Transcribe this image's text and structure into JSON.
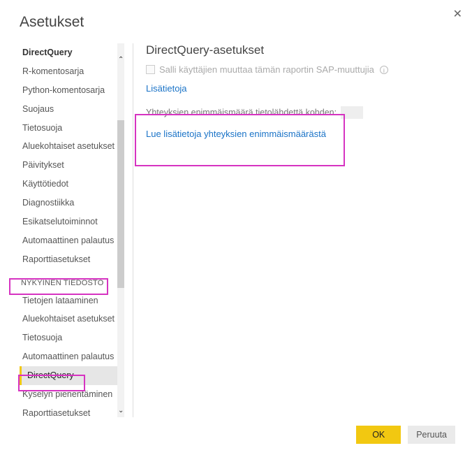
{
  "dialog": {
    "title": "Asetukset",
    "close_glyph": "✕"
  },
  "sidebar": {
    "global_items": [
      "DirectQuery",
      "R-komentosarja",
      "Python-komentosarja",
      "Suojaus",
      "Tietosuoja",
      "Aluekohtaiset asetukset",
      "Päivitykset",
      "Käyttötiedot",
      "Diagnostiikka",
      "Esikatselutoiminnot",
      "Automaattinen palautus",
      "Raporttiasetukset"
    ],
    "section_label": "NYKYINEN TIEDOSTO",
    "file_items": [
      "Tietojen lataaminen",
      "Aluekohtaiset asetukset",
      "Tietosuoja",
      "Automaattinen palautus",
      "DirectQuery",
      "Kyselyn pienentäminen",
      "Raporttiasetukset"
    ],
    "selected": "DirectQuery",
    "arrow_up": "⌃",
    "arrow_down": "⌄"
  },
  "content": {
    "heading": "DirectQuery-asetukset",
    "checkbox_label": "Salli käyttäjien muuttaa tämän raportin SAP-muuttujia",
    "info_glyph": "i",
    "link_more": "Lisätietoja",
    "max_conn_label": "Yhteyksien enimmäismäärä tietolähdettä kohden:",
    "max_conn_value": "",
    "link_conn": "Lue lisätietoja yhteyksien enimmäismäärästä"
  },
  "footer": {
    "ok": "OK",
    "cancel": "Peruuta"
  }
}
